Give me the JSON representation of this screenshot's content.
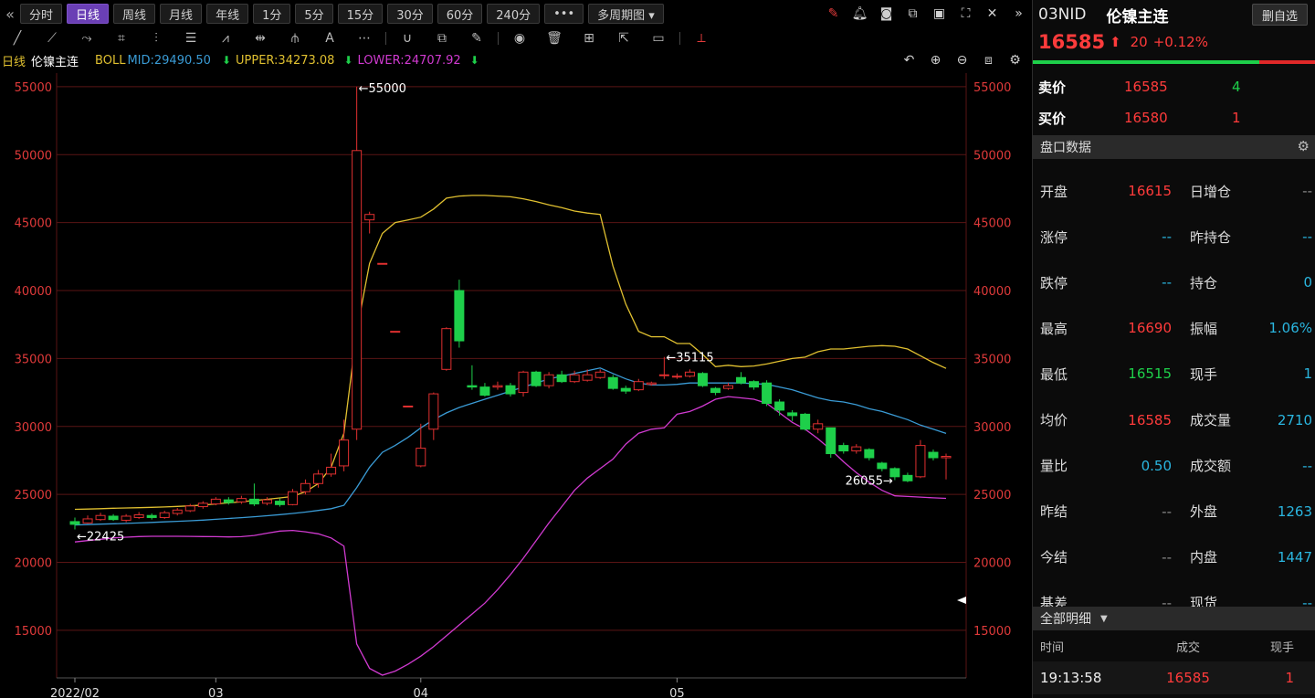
{
  "toolbar": {
    "periods": [
      "分时",
      "日线",
      "周线",
      "月线",
      "年线",
      "1分",
      "5分",
      "15分",
      "30分",
      "60分",
      "240分",
      "•••",
      "多周期图 ▾"
    ],
    "active_period": "日线"
  },
  "indicator": {
    "period": "日线",
    "name": "伦镍主连",
    "boll": "BOLL",
    "mid": "MID:29490.50",
    "upper": "UPPER:34273.08",
    "lower": "LOWER:24707.92"
  },
  "chart_data": {
    "type": "candlestick",
    "y_ticks": [
      55000,
      50000,
      45000,
      40000,
      35000,
      30000,
      25000,
      20000,
      15000
    ],
    "ylim": [
      11500,
      56000
    ],
    "x_ticks": [
      "2022/02",
      "03",
      "04",
      "05"
    ],
    "annotations": {
      "high": "←55000",
      "peak": "←35115",
      "low": "←22425",
      "trough": "26055→"
    },
    "colors": {
      "up": "#e03030",
      "down": "#1ecf4a",
      "upper": "#e0c030",
      "mid": "#3a9bd5",
      "lower": "#d03ad0",
      "grid": "#5a1515"
    },
    "candles": [
      [
        23000,
        22800,
        23300,
        22425
      ],
      [
        22900,
        23200,
        23450,
        22850
      ],
      [
        23150,
        23450,
        23650,
        23050
      ],
      [
        23400,
        23150,
        23550,
        23050
      ],
      [
        23100,
        23400,
        23550,
        22950
      ],
      [
        23300,
        23500,
        23700,
        23200
      ],
      [
        23450,
        23300,
        23600,
        23150
      ],
      [
        23300,
        23650,
        23800,
        23200
      ],
      [
        23600,
        23850,
        24000,
        23450
      ],
      [
        23800,
        24150,
        24300,
        23700
      ],
      [
        24100,
        24350,
        24500,
        23950
      ],
      [
        24300,
        24650,
        24800,
        24200
      ],
      [
        24600,
        24400,
        24800,
        24250
      ],
      [
        24450,
        24700,
        24900,
        24300
      ],
      [
        24650,
        24300,
        25800,
        24150
      ],
      [
        24350,
        24600,
        24800,
        24200
      ],
      [
        24500,
        24250,
        24700,
        24100
      ],
      [
        24250,
        25200,
        25400,
        24200
      ],
      [
        25200,
        25800,
        26100,
        25000
      ],
      [
        25800,
        26500,
        26800,
        25500
      ],
      [
        26500,
        27000,
        28000,
        26300
      ],
      [
        27100,
        29000,
        30500,
        26700
      ],
      [
        29800,
        50300,
        55000,
        29000
      ],
      [
        45200,
        45600,
        45800,
        44200
      ],
      [
        42000,
        42000,
        42000,
        42000
      ],
      [
        37000,
        37000,
        37000,
        37000
      ],
      [
        31500,
        31500,
        31500,
        31500
      ],
      [
        27100,
        28400,
        30200,
        27000
      ],
      [
        29800,
        32400,
        32500,
        29000
      ],
      [
        34200,
        37200,
        37300,
        34100
      ],
      [
        40000,
        36300,
        40800,
        35800
      ],
      [
        33000,
        32900,
        34500,
        32700
      ],
      [
        32900,
        32300,
        33200,
        32200
      ],
      [
        32900,
        33000,
        33300,
        32700
      ],
      [
        33000,
        32400,
        33200,
        32200
      ],
      [
        32500,
        34000,
        34100,
        32200
      ],
      [
        34000,
        33000,
        34100,
        32900
      ],
      [
        33000,
        33800,
        34000,
        32800
      ],
      [
        33800,
        33300,
        34100,
        33200
      ],
      [
        33300,
        33800,
        34100,
        33200
      ],
      [
        33400,
        33800,
        34200,
        33300
      ],
      [
        33600,
        34000,
        34200,
        33500
      ],
      [
        33600,
        32800,
        33800,
        32700
      ],
      [
        32800,
        32600,
        33000,
        32400
      ],
      [
        32700,
        33300,
        33500,
        32600
      ],
      [
        33100,
        33200,
        33300,
        33000
      ],
      [
        33800,
        33800,
        35115,
        33500
      ],
      [
        33700,
        33700,
        33900,
        33500
      ],
      [
        33700,
        34000,
        34200,
        33600
      ],
      [
        33900,
        33000,
        34000,
        32900
      ],
      [
        32800,
        32500,
        32900,
        32300
      ],
      [
        32800,
        33000,
        33200,
        32700
      ],
      [
        33600,
        33200,
        34000,
        33100
      ],
      [
        33300,
        32900,
        33400,
        32700
      ],
      [
        33200,
        31700,
        33400,
        31500
      ],
      [
        31800,
        31200,
        32000,
        30800
      ],
      [
        31000,
        30800,
        31200,
        30400
      ],
      [
        30900,
        29800,
        31000,
        29700
      ],
      [
        29800,
        30200,
        30500,
        29500
      ],
      [
        29900,
        28000,
        29900,
        27700
      ],
      [
        28600,
        28200,
        28800,
        28000
      ],
      [
        28200,
        28500,
        28700,
        28000
      ],
      [
        28300,
        27700,
        28400,
        27500
      ],
      [
        27300,
        26900,
        27400,
        26700
      ],
      [
        26900,
        26300,
        27000,
        26055
      ],
      [
        26400,
        26000,
        26600,
        25900
      ],
      [
        26300,
        28600,
        29000,
        26200
      ],
      [
        28100,
        27700,
        28300,
        27500
      ],
      [
        27700,
        27800,
        28000,
        26100
      ]
    ],
    "upper": [
      23900,
      23920,
      23950,
      23980,
      24000,
      24020,
      24050,
      24080,
      24120,
      24160,
      24220,
      24300,
      24380,
      24460,
      24550,
      24640,
      24740,
      24850,
      25200,
      25800,
      27000,
      29500,
      37000,
      42000,
      44200,
      45000,
      45200,
      45400,
      46000,
      46800,
      46950,
      47000,
      47000,
      46950,
      46900,
      46750,
      46550,
      46300,
      46100,
      45850,
      45700,
      45600,
      41800,
      39000,
      37000,
      36600,
      36600,
      36100,
      36100,
      35300,
      34400,
      34500,
      34400,
      34450,
      34600,
      34800,
      35000,
      35100,
      35500,
      35700,
      35700,
      35800,
      35900,
      35950,
      35900,
      35700,
      35200,
      34700,
      34273
    ],
    "mid": [
      22750,
      22780,
      22810,
      22840,
      22870,
      22900,
      22940,
      22980,
      23020,
      23060,
      23110,
      23170,
      23230,
      23290,
      23360,
      23430,
      23510,
      23600,
      23700,
      23820,
      23950,
      24200,
      25500,
      27000,
      28100,
      28600,
      29200,
      29900,
      30500,
      31000,
      31400,
      31700,
      32000,
      32300,
      32600,
      32900,
      33200,
      33500,
      33700,
      33900,
      34100,
      34300,
      33900,
      33500,
      33200,
      33050,
      33050,
      33100,
      33200,
      33200,
      33200,
      33200,
      33200,
      33150,
      33100,
      32900,
      32700,
      32400,
      32100,
      31900,
      31800,
      31600,
      31300,
      31100,
      30800,
      30500,
      30100,
      29800,
      29490
    ],
    "lower": [
      21500,
      21600,
      21700,
      21800,
      21850,
      21900,
      21920,
      21920,
      21920,
      21910,
      21900,
      21890,
      21870,
      21890,
      21980,
      22150,
      22300,
      22350,
      22250,
      22100,
      21800,
      21200,
      14000,
      12200,
      11700,
      12000,
      12500,
      13100,
      13800,
      14600,
      15400,
      16200,
      17000,
      18000,
      19100,
      20300,
      21600,
      22900,
      24100,
      25300,
      26200,
      26900,
      27600,
      28700,
      29500,
      29800,
      29900,
      30900,
      31100,
      31500,
      32000,
      32200,
      32100,
      32000,
      31700,
      31000,
      30300,
      29800,
      29100,
      28300,
      27400,
      26600,
      25900,
      25300,
      24900,
      24850,
      24800,
      24750,
      24707
    ]
  },
  "panel": {
    "code": "03NID",
    "name": "伦镍主连",
    "delete_label": "删自选",
    "price": "16585",
    "change": "20",
    "pct": "+0.12%",
    "ask_label": "卖价",
    "ask_price": "16585",
    "ask_qty": "4",
    "bid_label": "买价",
    "bid_price": "16580",
    "bid_qty": "1",
    "section_title": "盘口数据",
    "stats": [
      {
        "l1": "开盘",
        "v1": "16615",
        "c1": "c-red",
        "l2": "日增仓",
        "v2": "--",
        "c2": "c-gray"
      },
      {
        "l1": "涨停",
        "v1": "--",
        "c1": "c-cyan",
        "l2": "昨持仓",
        "v2": "--",
        "c2": "c-cyan"
      },
      {
        "l1": "跌停",
        "v1": "--",
        "c1": "c-cyan",
        "l2": "持仓",
        "v2": "0",
        "c2": "c-cyan"
      },
      {
        "l1": "最高",
        "v1": "16690",
        "c1": "c-red",
        "l2": "振幅",
        "v2": "1.06%",
        "c2": "c-cyan"
      },
      {
        "l1": "最低",
        "v1": "16515",
        "c1": "c-green",
        "l2": "现手",
        "v2": "1",
        "c2": "c-cyan"
      },
      {
        "l1": "均价",
        "v1": "16585",
        "c1": "c-red",
        "l2": "成交量",
        "v2": "2710",
        "c2": "c-cyan"
      },
      {
        "l1": "量比",
        "v1": "0.50",
        "c1": "c-cyan",
        "l2": "成交额",
        "v2": "--",
        "c2": "c-cyan"
      },
      {
        "l1": "昨结",
        "v1": "--",
        "c1": "c-gray",
        "l2": "外盘",
        "v2": "1263",
        "c2": "c-cyan"
      },
      {
        "l1": "今结",
        "v1": "--",
        "c1": "c-gray",
        "l2": "内盘",
        "v2": "1447",
        "c2": "c-cyan"
      },
      {
        "l1": "基差",
        "v1": "--",
        "c1": "c-gray",
        "l2": "现货",
        "v2": "--",
        "c2": "c-cyan"
      }
    ],
    "detail_title": "全部明细",
    "detail_cols": [
      "时间",
      "成交",
      "现手"
    ],
    "detail_row": {
      "time": "19:13:58",
      "price": "16585",
      "qty": "1"
    }
  }
}
